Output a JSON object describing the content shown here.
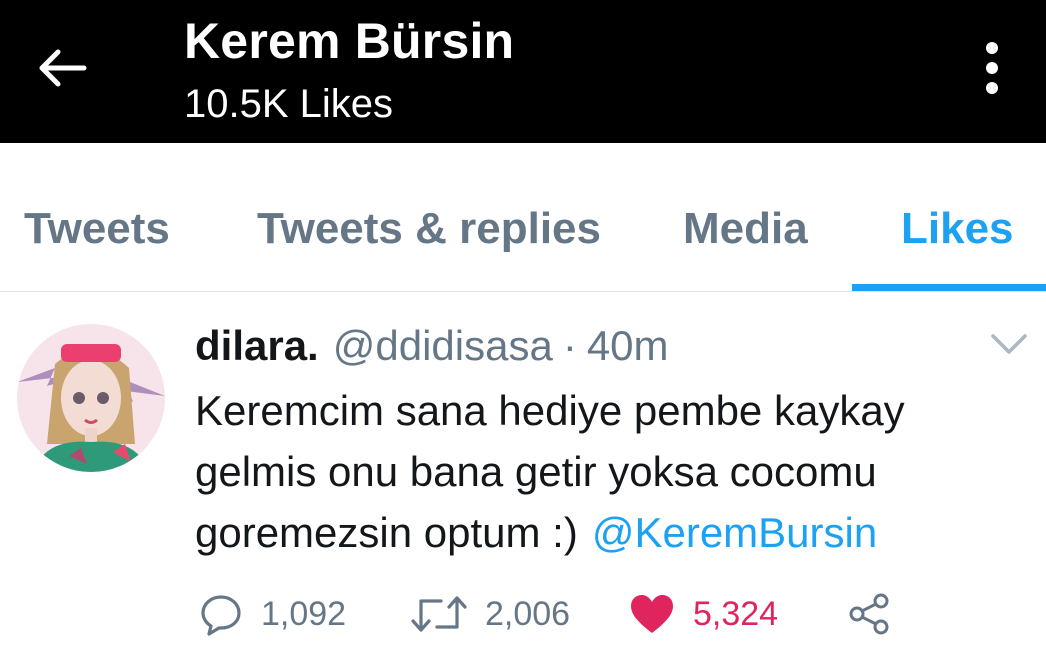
{
  "header": {
    "back_icon": "arrow-left-icon",
    "title": "Kerem Bürsin",
    "subtitle": "10.5K Likes",
    "more_icon": "vertical-ellipsis-icon"
  },
  "tabs": [
    {
      "label": "Tweets",
      "active": false
    },
    {
      "label": "Tweets & replies",
      "active": false
    },
    {
      "label": "Media",
      "active": false
    },
    {
      "label": "Likes",
      "active": true
    }
  ],
  "tweet": {
    "author_name": "dilara.",
    "handle": "@ddidisasa",
    "separator": "·",
    "time": "40m",
    "text_lines": [
      "Keremcim sana hediye pembe kaykay",
      "gelmis onu bana getir yoksa cocomu",
      "goremezsin optum :)"
    ],
    "mention": "@KeremBursin",
    "replies": "1,092",
    "retweets": "2,006",
    "likes": "5,324",
    "liked": true
  },
  "icons": {
    "reply": "reply-bubble-icon",
    "retweet": "retweet-icon",
    "like": "heart-icon",
    "share": "share-icon",
    "caret": "chevron-down-icon"
  },
  "colors": {
    "accent": "#1da1f2",
    "like": "#e0245e",
    "secondary_text": "#657786",
    "header_bg": "#000000"
  }
}
